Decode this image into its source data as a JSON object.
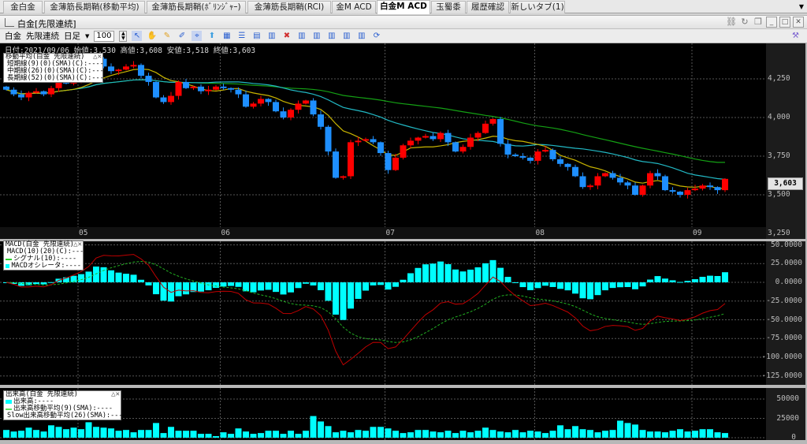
{
  "tabs": [
    {
      "label": "金白金"
    },
    {
      "label": "金薄筋長期鞘(移動平均)"
    },
    {
      "label": "金薄筋長期鞘(ﾎﾞﾘﾝｼﾞｬｰ)"
    },
    {
      "label": "金薄筋長期鞘(RCI)"
    },
    {
      "label": "金M ACD"
    },
    {
      "label": "白金M ACD"
    },
    {
      "label": "玉蜀黍"
    },
    {
      "label": "履歴確認"
    },
    {
      "label": "新しいタブ(1)"
    }
  ],
  "active_tab": 5,
  "window": {
    "title": "白金[先限連続]"
  },
  "toolbar": {
    "symbol": "白金",
    "contract": "先限連続",
    "period": "日足",
    "bars": "100"
  },
  "info_line": "日付:2021/09/06 始値:3,530 高値:3,608 安値:3,518 終値:3,603",
  "current_price": "3,603",
  "legends": {
    "ma": {
      "title": "移動平均(白金 先限連続)",
      "items": [
        "短期線(9)(0)(SMA)(C):----",
        "中期線(26)(0)(SMA)(C):----",
        "長期線(52)(0)(SMA)(C):----"
      ]
    },
    "macd": {
      "title": "MACD(白金 先限連続)",
      "items": [
        "MACD(10)(20)(C):----",
        "シグナル(10):----",
        "MACDオシレータ:----"
      ]
    },
    "volume": {
      "title": "出来高(白金 先限連続)",
      "items": [
        "出来高:----",
        "出来高移動平均(9)(SMA):----",
        "Slow出来高移動平均(26)(SMA):----"
      ]
    }
  },
  "colors": {
    "up": "#ff0000",
    "down": "#1e8fff",
    "ma_short": "#c8b400",
    "ma_mid": "#22b8c4",
    "ma_long": "#14a014",
    "macd": "#c00000",
    "signal": "#22b022",
    "osc": "#00ffff",
    "volume": "#00ffff"
  },
  "chart_data": [
    {
      "type": "candlestick",
      "title": "白金[先限連続]",
      "month_labels": [
        {
          "label": "05",
          "index": 10
        },
        {
          "label": "06",
          "index": 29
        },
        {
          "label": "07",
          "index": 51
        },
        {
          "label": "08",
          "index": 71
        },
        {
          "label": "09",
          "index": 92
        }
      ],
      "y_ticks": [
        {
          "v": 4250,
          "label": "4,250"
        },
        {
          "v": 4000,
          "label": "4,000"
        },
        {
          "v": 3750,
          "label": "3,750"
        },
        {
          "v": 3500,
          "label": "3,500"
        },
        {
          "v": 3250,
          "label": "3,250"
        }
      ],
      "ylim": [
        3250,
        4300
      ],
      "first_open": 4200,
      "close": [
        4180,
        4150,
        4130,
        4160,
        4170,
        4150,
        4190,
        4230,
        4220,
        4240,
        4260,
        4300,
        4380,
        4330,
        4300,
        4310,
        4330,
        4340,
        4270,
        4230,
        4130,
        4100,
        4140,
        4230,
        4190,
        4200,
        4170,
        4180,
        4200,
        4190,
        4180,
        4150,
        4070,
        4090,
        4120,
        4100,
        4040,
        4000,
        4050,
        4090,
        4110,
        4020,
        3940,
        3780,
        3610,
        3620,
        3840,
        3850,
        3860,
        3840,
        3770,
        3660,
        3740,
        3820,
        3850,
        3870,
        3880,
        3860,
        3900,
        3840,
        3780,
        3810,
        3870,
        3900,
        3960,
        3990,
        3830,
        3760,
        3750,
        3740,
        3720,
        3780,
        3790,
        3730,
        3700,
        3680,
        3620,
        3550,
        3560,
        3620,
        3640,
        3610,
        3580,
        3560,
        3500,
        3560,
        3640,
        3620,
        3530,
        3520,
        3500,
        3530,
        3540,
        3560,
        3550,
        3530,
        3603
      ],
      "last": {
        "open": 3530,
        "high": 3608,
        "low": 3518,
        "close": 3603
      },
      "ma_periods": [
        9,
        26,
        52
      ]
    },
    {
      "type": "line+bar",
      "title": "MACD",
      "params": {
        "fast": 10,
        "slow": 20,
        "signal": 10
      },
      "y_ticks": [
        {
          "v": 50,
          "label": "50.0000"
        },
        {
          "v": 25,
          "label": "25.0000"
        },
        {
          "v": 0,
          "label": "0.0000"
        },
        {
          "v": -25,
          "label": "-25.0000"
        },
        {
          "v": -50,
          "label": "-50.0000"
        },
        {
          "v": -75,
          "label": "-75.0000"
        },
        {
          "v": -100,
          "label": "-100.0000"
        },
        {
          "v": -125,
          "label": "-125.0000"
        }
      ],
      "ylim": [
        -135,
        55
      ]
    },
    {
      "type": "bar",
      "title": "出来高",
      "y_ticks": [
        {
          "v": 50000,
          "label": "50000"
        },
        {
          "v": 25000,
          "label": "25000"
        },
        {
          "v": 0,
          "label": "0"
        }
      ],
      "values": [
        10000,
        8000,
        9000,
        13000,
        10000,
        8000,
        16000,
        14000,
        11000,
        13000,
        11000,
        20000,
        14000,
        13000,
        12000,
        9000,
        10000,
        7000,
        10000,
        10000,
        19000,
        6000,
        14000,
        9000,
        9000,
        9000,
        5000,
        5000,
        2000,
        7000,
        5000,
        12000,
        8000,
        5000,
        6000,
        9000,
        9000,
        5000,
        9000,
        5000,
        9000,
        28000,
        21000,
        15000,
        7000,
        9000,
        7000,
        10000,
        9000,
        14000,
        14000,
        12000,
        9000,
        6000,
        7000,
        10000,
        10000,
        8000,
        7000,
        9000,
        6000,
        9000,
        7000,
        9000,
        13000,
        10000,
        8000,
        7000,
        10000,
        7000,
        9000,
        8000,
        6000,
        9000,
        16000,
        11000,
        15000,
        11000,
        10000,
        7000,
        9000,
        10000,
        22000,
        19000,
        17000,
        10000,
        8000,
        8000,
        7000,
        9000,
        11000,
        8000,
        9000,
        11000,
        11000,
        7000,
        6000
      ]
    }
  ]
}
